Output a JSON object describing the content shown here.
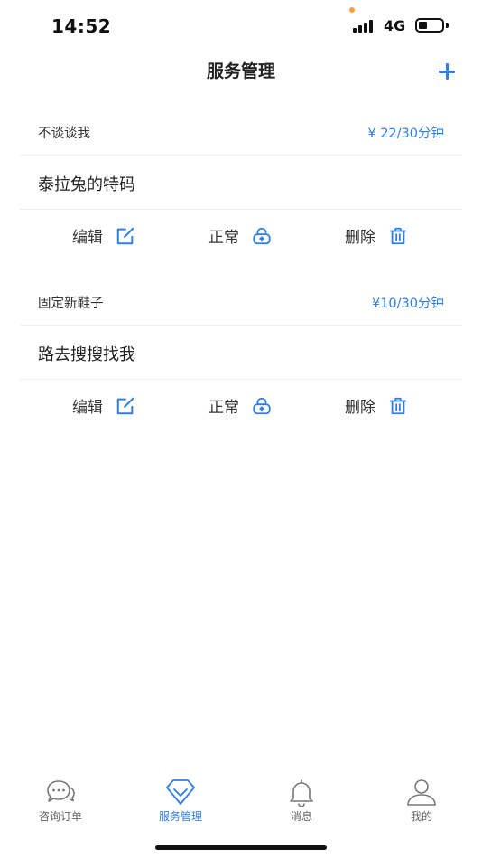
{
  "status_bar": {
    "time": "14:52",
    "network": "4G"
  },
  "nav": {
    "title": "服务管理",
    "add_icon": "plus-icon"
  },
  "services": [
    {
      "name": "不谈谈我",
      "price": "¥ 22/30分钟",
      "description": "泰拉兔的特码",
      "actions": {
        "edit": "编辑",
        "status": "正常",
        "delete": "删除"
      }
    },
    {
      "name": "固定新鞋子",
      "price": "¥10/30分钟",
      "description": "路去搜搜找我",
      "actions": {
        "edit": "编辑",
        "status": "正常",
        "delete": "删除"
      }
    }
  ],
  "tabs": [
    {
      "label": "咨询订单",
      "icon": "chat-bubble-icon",
      "active": false
    },
    {
      "label": "服务管理",
      "icon": "diamond-icon",
      "active": true
    },
    {
      "label": "消息",
      "icon": "bell-icon",
      "active": false
    },
    {
      "label": "我的",
      "icon": "person-icon",
      "active": false
    }
  ],
  "colors": {
    "accent": "#2f7fe0",
    "text": "#222222",
    "muted": "#666666"
  }
}
